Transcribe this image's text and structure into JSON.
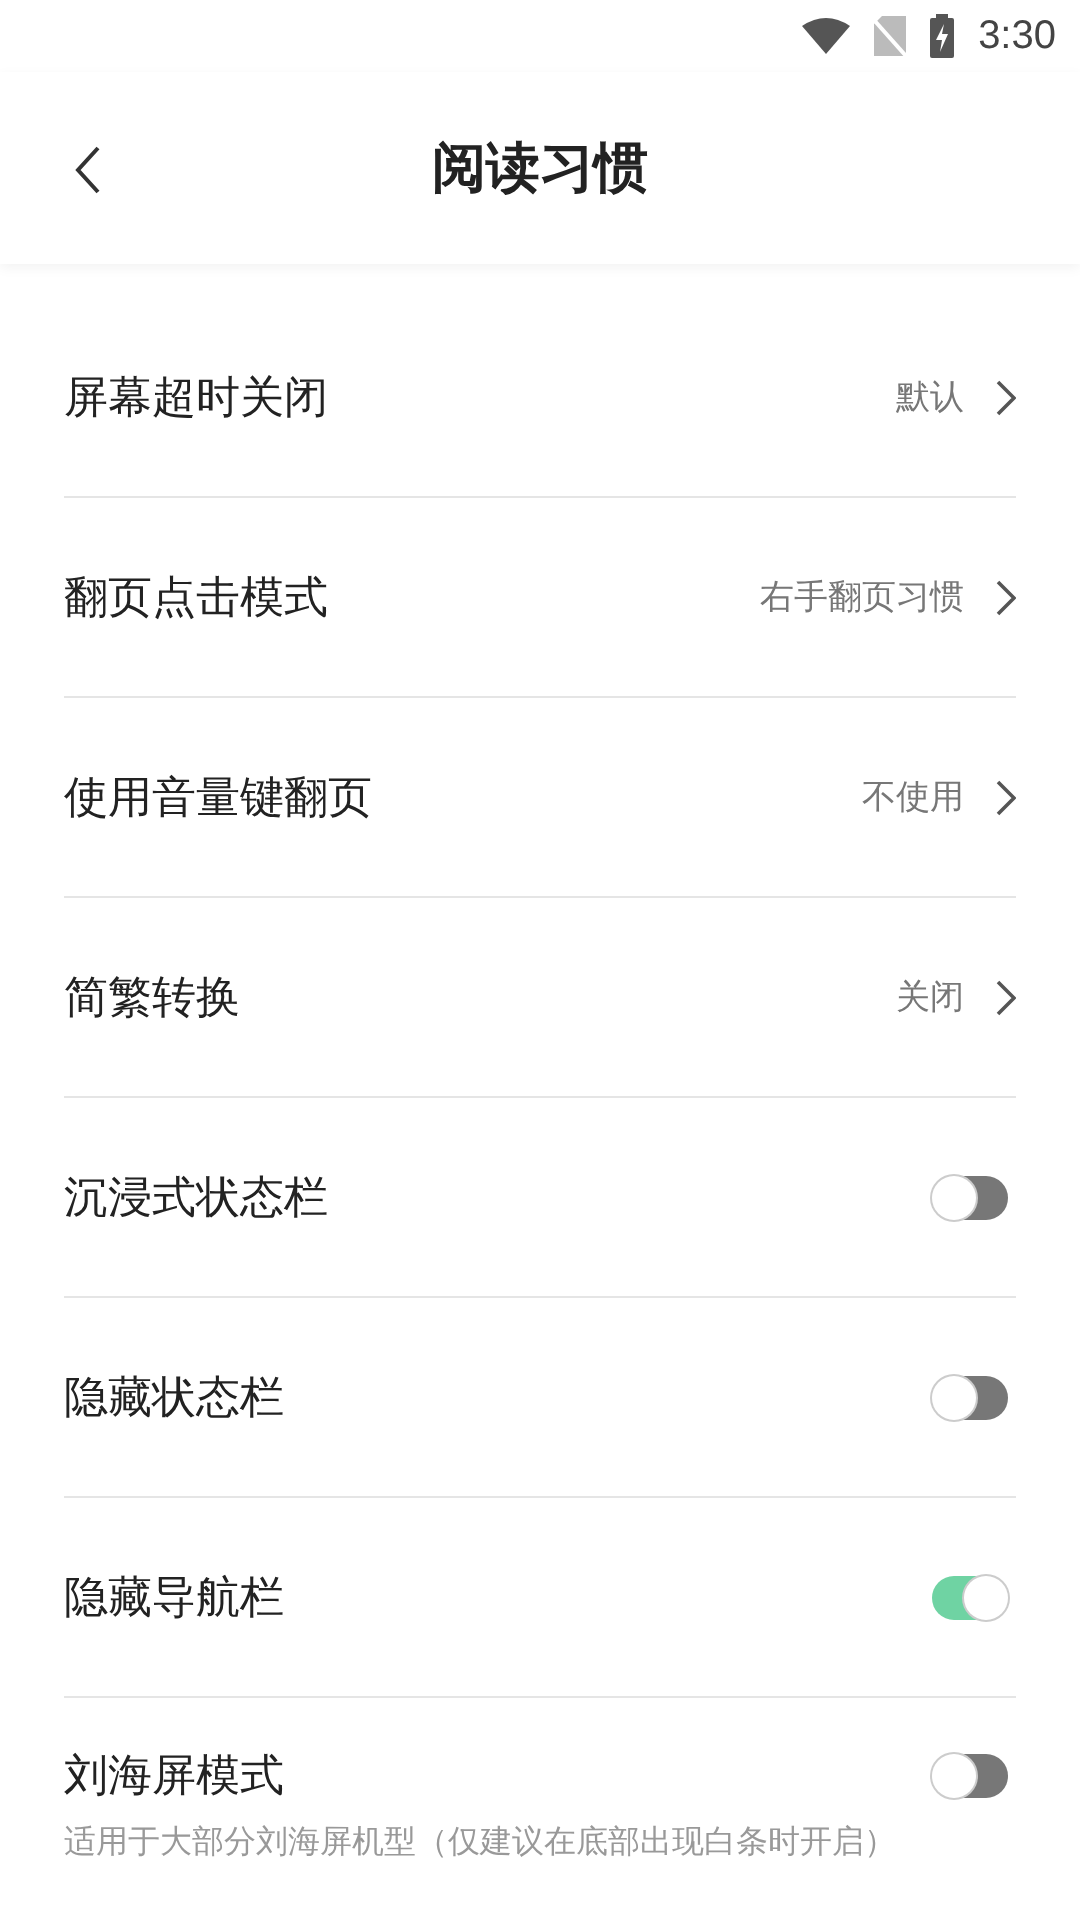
{
  "status_bar": {
    "time": "3:30"
  },
  "header": {
    "title": "阅读习惯"
  },
  "settings": [
    {
      "kind": "link",
      "label": "屏幕超时关闭",
      "value": "默认"
    },
    {
      "kind": "link",
      "label": "翻页点击模式",
      "value": "右手翻页习惯"
    },
    {
      "kind": "link",
      "label": "使用音量键翻页",
      "value": "不使用"
    },
    {
      "kind": "link",
      "label": "简繁转换",
      "value": "关闭"
    },
    {
      "kind": "toggle",
      "label": "沉浸式状态栏",
      "on": false
    },
    {
      "kind": "toggle",
      "label": "隐藏状态栏",
      "on": false
    },
    {
      "kind": "toggle",
      "label": "隐藏导航栏",
      "on": true
    },
    {
      "kind": "toggle",
      "label": "刘海屏模式",
      "on": false,
      "description": "适用于大部分刘海屏机型（仅建议在底部出现白条时开启）"
    }
  ]
}
